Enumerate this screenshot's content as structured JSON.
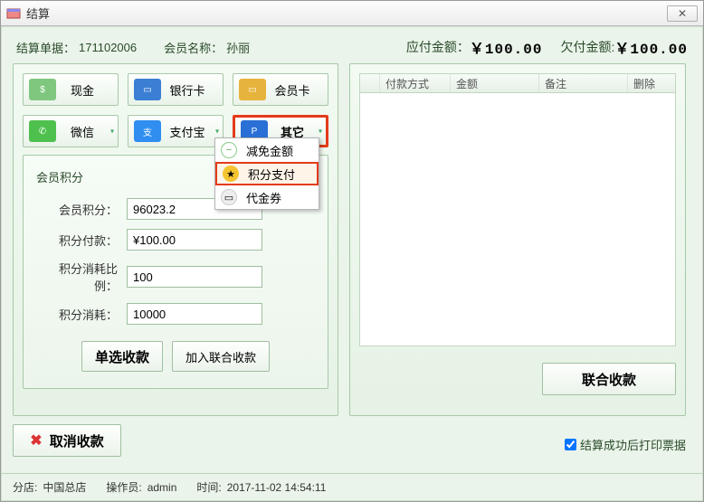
{
  "window": {
    "title": "结算"
  },
  "header": {
    "order_no_label": "结算单据：",
    "order_no": "171102006",
    "member_name_label": "会员名称：",
    "member_name": "孙丽",
    "payable_label": "应付金额：",
    "payable_value": "￥100.00",
    "owe_label": "欠付金额:",
    "owe_value": "￥100.00"
  },
  "pay_methods": {
    "cash": "现金",
    "bank": "银行卡",
    "member": "会员卡",
    "wechat": "微信",
    "alipay": "支付宝",
    "other": "其它"
  },
  "other_menu": {
    "reduce": "减免金额",
    "points_pay": "积分支付",
    "voucher": "代金券"
  },
  "points_group": {
    "title": "会员积分",
    "balance_label": "会员积分：",
    "balance": "96023.2",
    "pay_label": "积分付款：",
    "pay": "¥100.00",
    "ratio_label": "积分消耗比例：",
    "ratio": "100",
    "consume_label": "积分消耗：",
    "consume": "10000",
    "single_btn": "单选收款",
    "join_btn": "加入联合收款"
  },
  "table": {
    "col_checkbox": "",
    "col_method": "付款方式",
    "col_amount": "金额",
    "col_remark": "备注",
    "col_delete": "删除"
  },
  "right_actions": {
    "combine": "联合收款"
  },
  "footer": {
    "cancel": "取消收款",
    "print_label": "结算成功后打印票据"
  },
  "status": {
    "branch_label": "分店:",
    "branch": "中国总店",
    "operator_label": "操作员:",
    "operator": "admin",
    "time_label": "时间:",
    "time": "2017-11-02 14:54:11"
  }
}
